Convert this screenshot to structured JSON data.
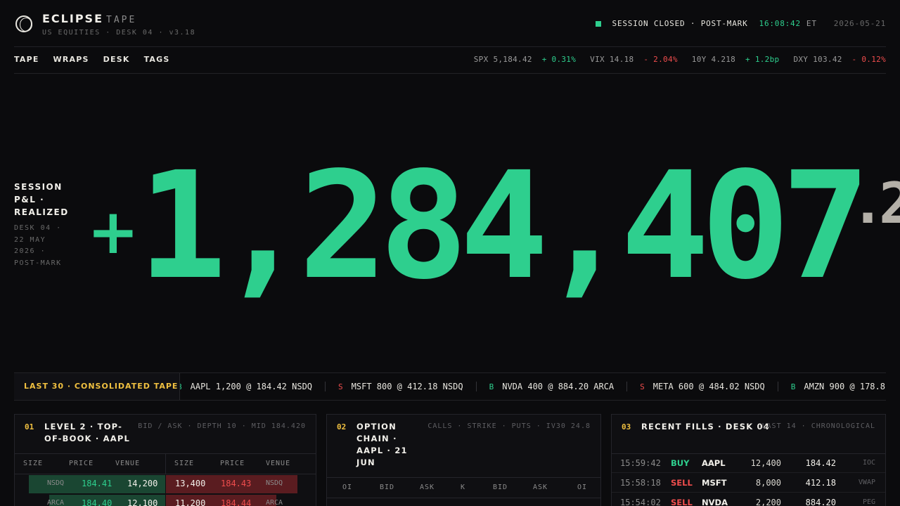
{
  "header": {
    "brand": "ECLIPSE",
    "brand_sub": "TAPE",
    "meta": "US EQUITIES · DESK 04 · v3.18",
    "status_text": "SESSION CLOSED · POST-MARK",
    "status_time": "16:08:42",
    "status_tz": "ET",
    "status_date": "2026-05-21"
  },
  "nav": {
    "tabs": [
      "TAPE",
      "WRAPS",
      "DESK",
      "TAGS"
    ]
  },
  "tickers": [
    {
      "label": "SPX 5,184.42",
      "change": "+ 0.31%",
      "dir": "up"
    },
    {
      "label": "VIX 14.18",
      "change": "- 2.04%",
      "dir": "down"
    },
    {
      "label": "10Y 4.218",
      "change": "+ 1.2bp",
      "dir": "up"
    },
    {
      "label": "DXY 103.42",
      "change": "- 0.12%",
      "dir": "down"
    }
  ],
  "pnl": {
    "label": "SESSION P&L · REALIZED",
    "meta": "DESK 04 · 22 MAY 2026 · POST-MARK",
    "sign": "+",
    "value": "1,284,407",
    "cents": ".2"
  },
  "tape": {
    "title": "LAST 30 · CONSOLIDATED TAPE",
    "items": [
      {
        "side": "B",
        "text": "AAPL 1,200 @ 184.42 NSDQ"
      },
      {
        "side": "S",
        "text": "MSFT 800 @ 412.18 NSDQ"
      },
      {
        "side": "B",
        "text": "NVDA 400 @ 884.20 ARCA"
      },
      {
        "side": "S",
        "text": "META 600 @ 484.02 NSDQ"
      },
      {
        "side": "B",
        "text": "AMZN 900 @ 178.8"
      }
    ]
  },
  "orderbook": {
    "num": "01",
    "title": "LEVEL 2 · TOP-OF-BOOK · AAPL",
    "meta": "BID / ASK · DEPTH 10 · MID 184.420",
    "headers": [
      "SIZE",
      "PRICE",
      "VENUE",
      "SIZE",
      "PRICE",
      "VENUE"
    ],
    "rows": [
      {
        "bid_venue": "NSDQ",
        "bid_price": "184.41",
        "bid_size": "14,200",
        "ask_size": "13,400",
        "ask_price": "184.43",
        "ask_venue": "NSDQ",
        "bid_depth": 0.95,
        "ask_depth": 0.88
      },
      {
        "bid_venue": "ARCA",
        "bid_price": "184.40",
        "bid_size": "12,100",
        "ask_size": "11,200",
        "ask_price": "184.44",
        "ask_venue": "ARCA",
        "bid_depth": 0.81,
        "ask_depth": 0.74
      }
    ]
  },
  "options": {
    "num": "02",
    "title": "OPTION CHAIN · AAPL · 21 JUN",
    "meta": "CALLS · STRIKE · PUTS · IV30 24.8",
    "headers": [
      "OI",
      "BID",
      "ASK",
      "K",
      "BID",
      "ASK",
      "OI"
    ]
  },
  "fills": {
    "num": "03",
    "title": "RECENT FILLS · DESK 04",
    "meta": "LAST 14 · CHRONOLOGICAL",
    "rows": [
      {
        "time": "15:59:42",
        "side": "BUY",
        "sym": "AAPL",
        "qty": "12,400",
        "px": "184.42",
        "type": "IOC"
      },
      {
        "time": "15:58:18",
        "side": "SELL",
        "sym": "MSFT",
        "qty": "8,000",
        "px": "412.18",
        "type": "VWAP"
      },
      {
        "time": "15:54:02",
        "side": "SELL",
        "sym": "NVDA",
        "qty": "2,200",
        "px": "884.20",
        "type": "PEG"
      }
    ]
  },
  "colors": {
    "accent_green": "#2ecf8e",
    "accent_red": "#ef4d4d",
    "accent_amber": "#f0c040",
    "background": "#0b0b0d"
  }
}
